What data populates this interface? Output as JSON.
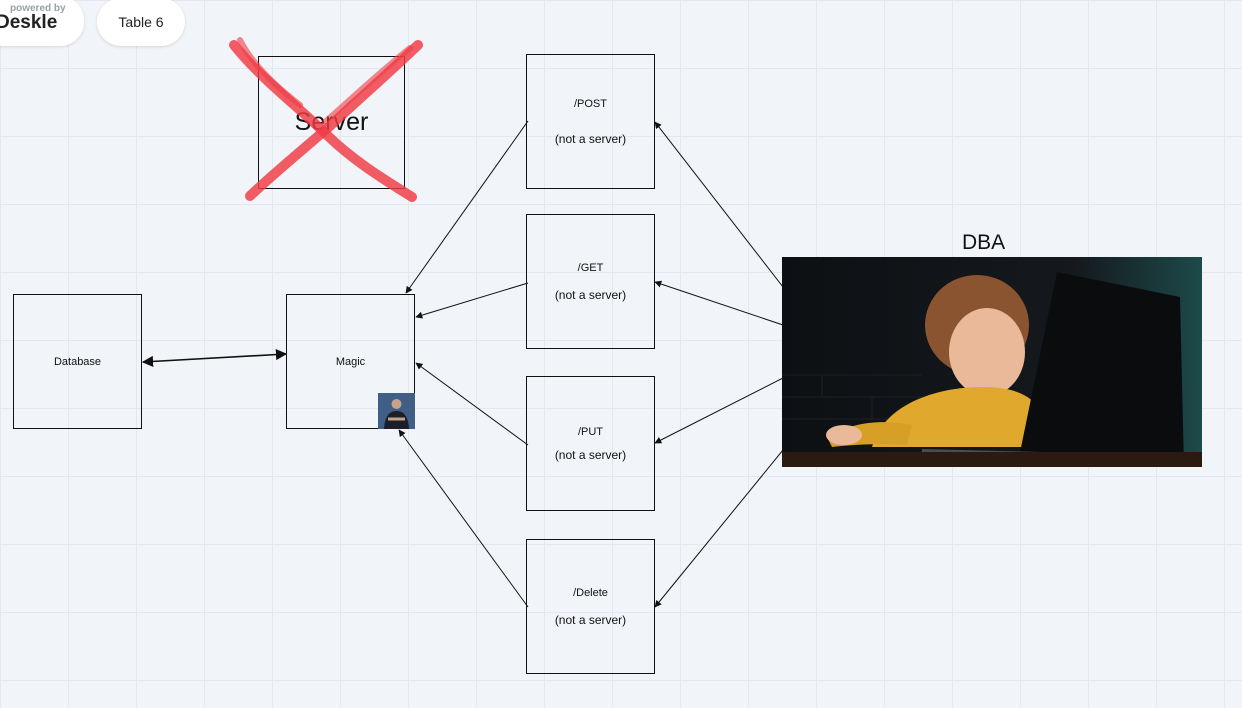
{
  "toolbar": {
    "powered_by": "powered by",
    "brand_name": "Deskle",
    "table_label": "Table 6"
  },
  "diagram": {
    "server": {
      "label": "Server",
      "crossed_out": true
    },
    "database": {
      "label": "Database"
    },
    "magic": {
      "label": "Magic"
    },
    "endpoints": [
      {
        "method": "/POST",
        "note": "(not a server)"
      },
      {
        "method": "/GET",
        "note": "(not a server)"
      },
      {
        "method": "/PUT",
        "note": "(not a server)"
      },
      {
        "method": "/Delete",
        "note": "(not a server)"
      }
    ],
    "dba": {
      "label": "DBA"
    }
  },
  "colors": {
    "cross_mark": "#f03a43",
    "stroke": "#111111",
    "canvas": "#f1f4f8"
  },
  "icons": {
    "brand": "deskle-logo",
    "avatar": "person-avatar",
    "photo": "child-at-laptop-photo"
  }
}
